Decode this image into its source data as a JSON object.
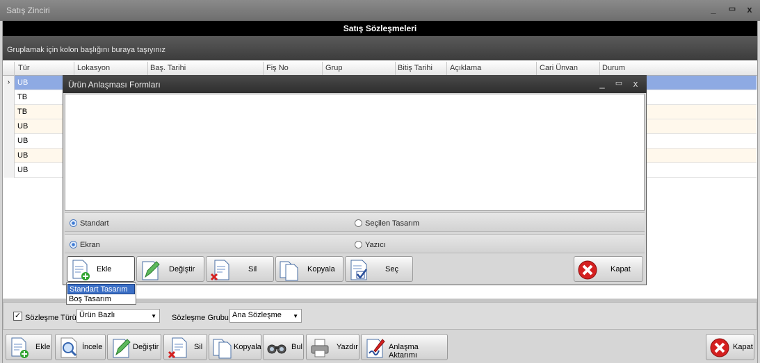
{
  "window": {
    "title": "Satış Zinciri",
    "min": "_",
    "max": "▭",
    "close": "x"
  },
  "banner": "Satış Sözleşmeleri",
  "group_hint": "Gruplamak için kolon başlığını buraya taşıyınız",
  "grid": {
    "columns": [
      "Tür",
      "Lokasyon",
      "Baş. Tarihi",
      "Fiş No",
      "Grup",
      "Bitiş Tarihi",
      "Açıklama",
      "Cari Ünvan",
      "Durum"
    ],
    "rows": [
      "UB",
      "TB",
      "TB",
      "UB",
      "UB",
      "UB",
      "UB"
    ],
    "selected_indicator": "›"
  },
  "dialog": {
    "title": "Ürün Anlaşması Formları",
    "min": "_",
    "max": "▭",
    "close": "x",
    "radio_standart": "Standart",
    "radio_secilen": "Seçilen Tasarım",
    "radio_ekran": "Ekran",
    "radio_yazici": "Yazıcı",
    "btn_ekle": "Ekle",
    "btn_degistir": "Değiştir",
    "btn_sil": "Sil",
    "btn_kopyala": "Kopyala",
    "btn_sec": "Seç",
    "btn_kapat": "Kapat"
  },
  "menu": {
    "item1": "Standart Tasarım",
    "item2": "Boş Tasarım"
  },
  "filter": {
    "check_mark": "✓",
    "type_label": "Sözleşme Türü",
    "type_value": "Ürün Bazlı",
    "group_label": "Sözleşme Grubu",
    "group_value": "Ana Sözleşme",
    "arrow": "▼"
  },
  "toolbar": {
    "ekle": "Ekle",
    "incele": "İncele",
    "degistir": "Değiştir",
    "sil": "Sil",
    "kopyala": "Kopyala",
    "bul": "Bul",
    "yazdir": "Yazdır",
    "aktarim": "Anlaşma Aktarımı",
    "kapat": "Kapat"
  },
  "colors": {
    "banner": "#000000",
    "selected_row": "#8eaae3",
    "close_red": "#d42020",
    "menu_highlight": "#3b6fc6"
  }
}
